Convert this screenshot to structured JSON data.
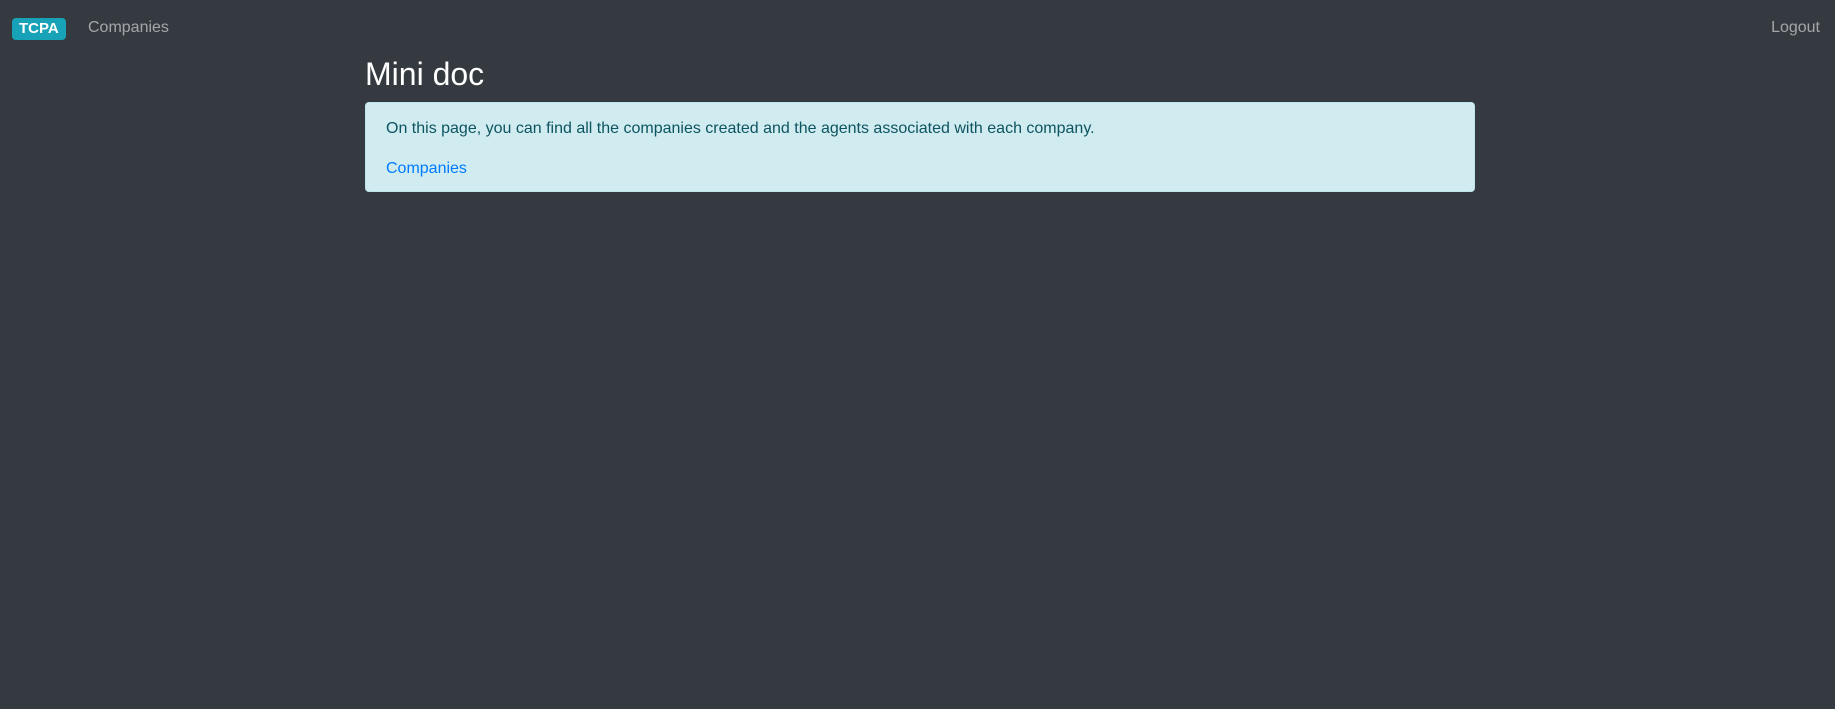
{
  "navbar": {
    "brand": "TCPA",
    "companies_link": "Companies",
    "logout_link": "Logout"
  },
  "main": {
    "title": "Mini doc",
    "alert": {
      "text": "On this page, you can find all the companies created and the agents associated with each company.",
      "link": "Companies"
    }
  },
  "colors": {
    "background": "#343a40",
    "brand": "#17a2b8",
    "alert_bg": "#d1ecf1",
    "link": "#007bff"
  }
}
